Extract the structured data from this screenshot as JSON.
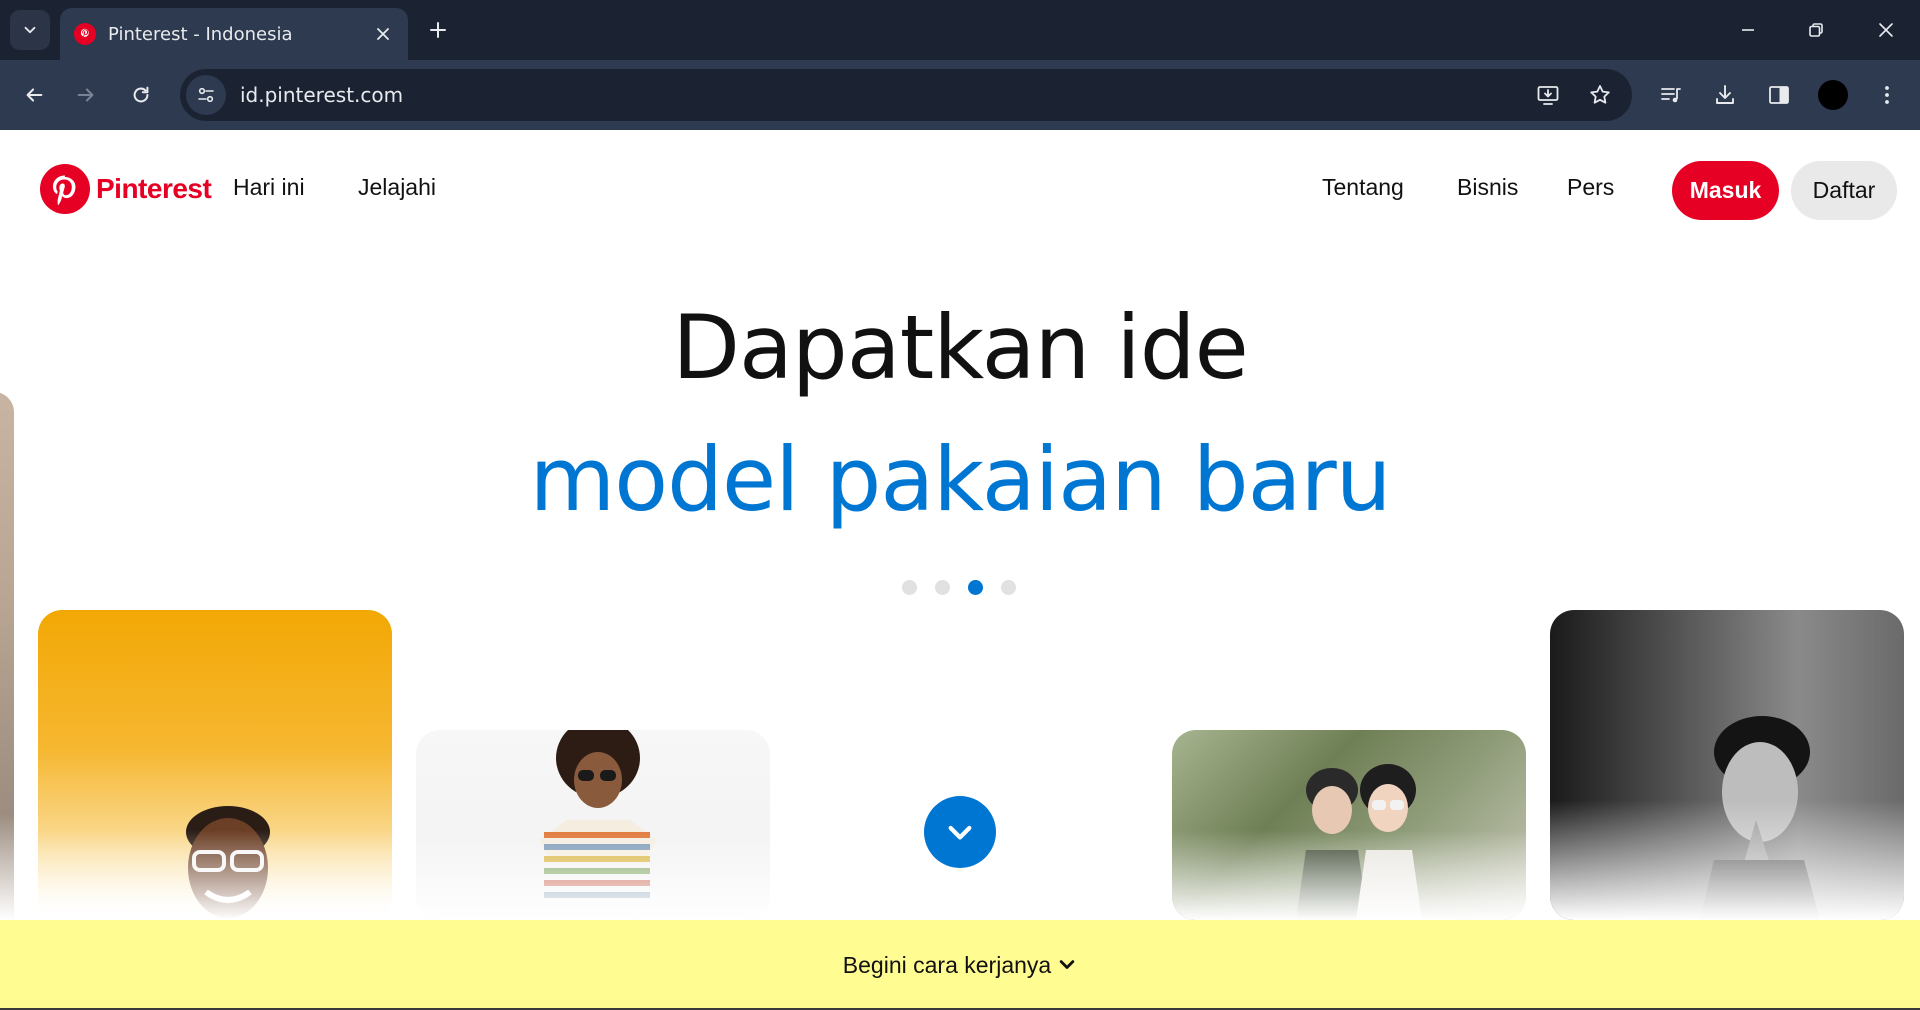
{
  "browser": {
    "tab_title": "Pinterest - Indonesia",
    "url": "id.pinterest.com",
    "icons": {
      "tab_dropdown": "chevron-down-icon",
      "tab_close": "close-icon",
      "new_tab": "plus-icon",
      "minimize": "minimize-icon",
      "restore": "restore-icon",
      "close_window": "close-icon",
      "back": "arrow-left-icon",
      "forward": "arrow-right-icon",
      "reload": "reload-icon",
      "site_info": "tune-icon",
      "install": "install-app-icon",
      "bookmark": "star-icon",
      "media": "media-queue-icon",
      "downloads": "download-icon",
      "side_panel": "side-panel-icon",
      "menu": "kebab-menu-icon"
    }
  },
  "header": {
    "logo_text": "Pinterest",
    "nav_left": [
      "Hari ini",
      "Jelajahi"
    ],
    "nav_right": [
      "Tentang",
      "Bisnis",
      "Pers"
    ],
    "login_label": "Masuk",
    "signup_label": "Daftar"
  },
  "hero": {
    "headline": "Dapatkan ide",
    "subline": "model pakaian baru",
    "carousel": {
      "count": 4,
      "active_index": 3
    }
  },
  "footer_bar": {
    "label": "Begini cara kerjanya"
  },
  "colors": {
    "brand_red": "#e60023",
    "accent_blue": "#0076d3",
    "footer_yellow": "#fffd92",
    "chrome_dark": "#1b2333",
    "chrome_mid": "#2e3a50"
  }
}
